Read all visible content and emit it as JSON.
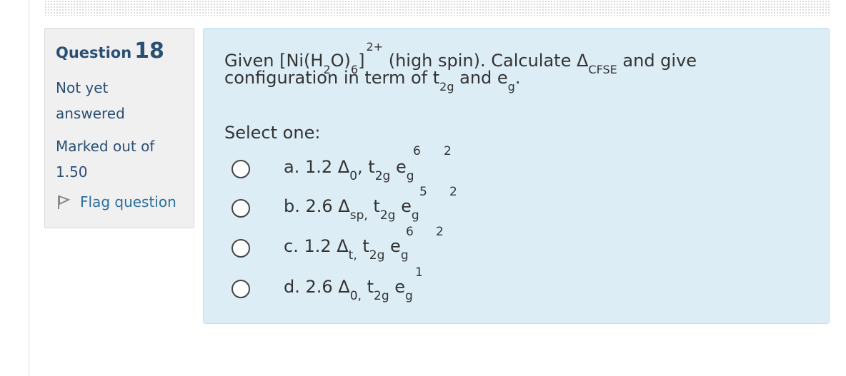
{
  "sidebar": {
    "question_label": "Question",
    "question_number": "18",
    "state_text": "Not yet answered",
    "grade_text": "Marked out of 1.50",
    "flag_label": "Flag question"
  },
  "question": {
    "line1": {
      "prefix": "Given [Ni(H",
      "sub_2": "2",
      "mid": "O)",
      "sub_6": "6",
      "bracket": "]",
      "charge": "2+",
      "after": " (high spin). Calculate Δ",
      "cfse": "CFSE",
      "end": " and give"
    },
    "line2": {
      "prefix": "configuration in term of t",
      "t2g": "2g",
      "mid": " and e",
      "eg": "g",
      "end": "."
    },
    "prompt": "Select one:"
  },
  "answers": [
    {
      "prefix": "a. 1.2 Δ",
      "delta_sub": "0",
      "comma": ", t",
      "t_sub": "2g",
      "e": "e",
      "e_sub": "g",
      "t_sup": "6",
      "e_sup": "2"
    },
    {
      "prefix": "b. 2.6 Δ",
      "delta_sub": "sp,",
      "comma": " t",
      "t_sub": "2g",
      "e": "e",
      "e_sub": "g",
      "t_sup": "5",
      "e_sup": "2"
    },
    {
      "prefix": "c. 1.2 Δ",
      "delta_sub": "t,",
      "comma": " t",
      "t_sub": "2g",
      "e": "e",
      "e_sub": "g",
      "t_sup": "6",
      "e_sup": "2"
    },
    {
      "prefix": "d. 2.6 Δ",
      "delta_sub": "0,",
      "comma": " t",
      "t_sub": "2g",
      "e": "e",
      "e_sub": "g",
      "t_sup": "",
      "e_sup": "1"
    }
  ]
}
